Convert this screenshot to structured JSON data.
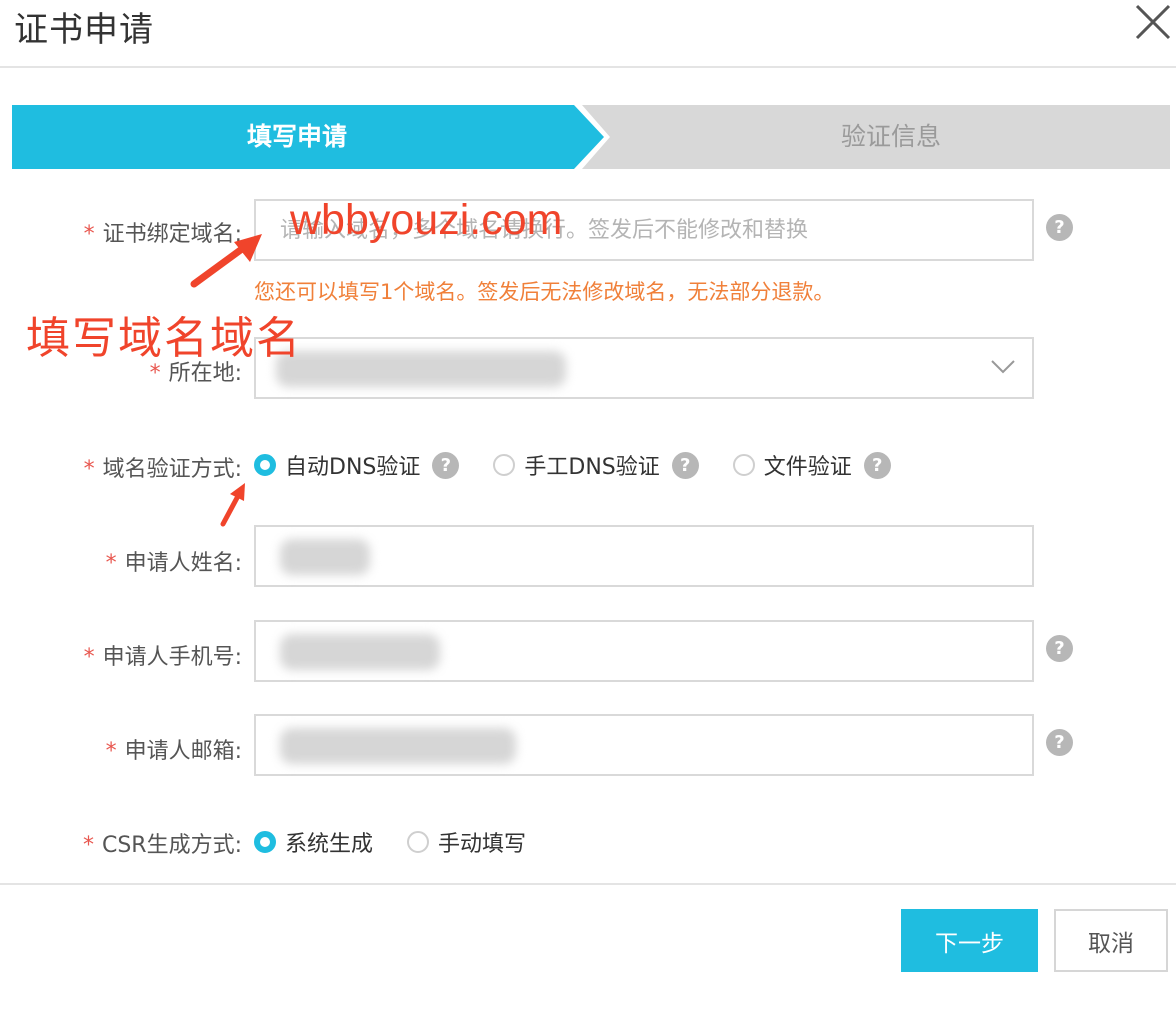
{
  "dialog": {
    "title": "证书申请",
    "close_icon": "close-icon"
  },
  "steps": [
    {
      "label": "填写申请",
      "active": true
    },
    {
      "label": "验证信息",
      "active": false
    }
  ],
  "form": {
    "domain": {
      "required_mark": "*",
      "label": "证书绑定域名:",
      "placeholder": "请输入域名，多个域名请换行。签发后不能修改和替换",
      "hint": "您还可以填写1个域名。签发后无法修改域名，无法部分退款。"
    },
    "location": {
      "required_mark": "*",
      "label": "所在地:"
    },
    "verify_method": {
      "required_mark": "*",
      "label": "域名验证方式:",
      "options": [
        {
          "label": "自动DNS验证",
          "checked": true
        },
        {
          "label": "手工DNS验证",
          "checked": false
        },
        {
          "label": "文件验证",
          "checked": false
        }
      ]
    },
    "applicant_name": {
      "required_mark": "*",
      "label": "申请人姓名:"
    },
    "applicant_phone": {
      "required_mark": "*",
      "label": "申请人手机号:"
    },
    "applicant_email": {
      "required_mark": "*",
      "label": "申请人邮箱:"
    },
    "csr_method": {
      "required_mark": "*",
      "label": "CSR生成方式:",
      "options": [
        {
          "label": "系统生成",
          "checked": true
        },
        {
          "label": "手动填写",
          "checked": false
        }
      ]
    },
    "help_glyph": "?"
  },
  "footer": {
    "next_label": "下一步",
    "cancel_label": "取消"
  },
  "annotations": {
    "domain_overlay": "wbbyouzi.com",
    "caption": "填写域名域名"
  },
  "colors": {
    "accent": "#1fbde0",
    "annotation": "#f0442b",
    "hint": "#f0803a",
    "required": "#e8574f"
  }
}
